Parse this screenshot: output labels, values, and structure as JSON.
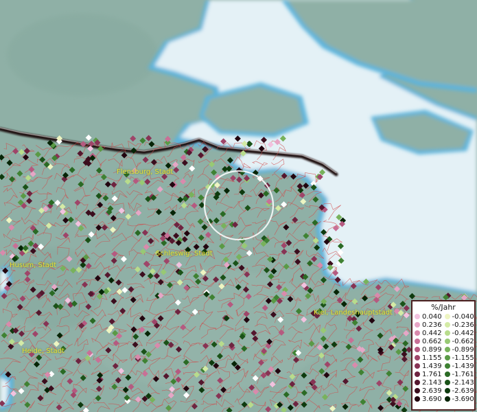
{
  "cities": [
    {
      "name": "Flensburg, Stadt"
    },
    {
      "name": "Husum, Stadt"
    },
    {
      "name": "Schleswig, Stadt"
    },
    {
      "name": "Kiel, Landeshauptstadt"
    },
    {
      "name": "Heide, Stadt"
    }
  ],
  "legend": {
    "title": "%/Jahr",
    "positive": [
      {
        "label": "0.040",
        "color": "#f2c2df"
      },
      {
        "label": "0.236",
        "color": "#e6a6c6"
      },
      {
        "label": "0.442",
        "color": "#d98aac"
      },
      {
        "label": "0.662",
        "color": "#c87096"
      },
      {
        "label": "0.899",
        "color": "#b55a80"
      },
      {
        "label": "1.155",
        "color": "#9f4569"
      },
      {
        "label": "1.439",
        "color": "#873354"
      },
      {
        "label": "1.761",
        "color": "#6e2440"
      },
      {
        "label": "2.143",
        "color": "#55172e"
      },
      {
        "label": "2.639",
        "color": "#3b0d1d"
      },
      {
        "label": "3.690",
        "color": "#22050f"
      }
    ],
    "negative": [
      {
        "label": "-0.040",
        "color": "#eef5c2"
      },
      {
        "label": "-0.236",
        "color": "#d4eba6"
      },
      {
        "label": "-0.442",
        "color": "#b8dc8c"
      },
      {
        "label": "-0.662",
        "color": "#98c974"
      },
      {
        "label": "-0.899",
        "color": "#78b25c"
      },
      {
        "label": "-1.155",
        "color": "#5a9a46"
      },
      {
        "label": "-1.439",
        "color": "#3f8233"
      },
      {
        "label": "-1.761",
        "color": "#2a6a24"
      },
      {
        "label": "-2.143",
        "color": "#1a5218"
      },
      {
        "label": "-2.639",
        "color": "#0e3a0e"
      },
      {
        "label": "-3.690",
        "color": "#062406"
      }
    ]
  },
  "colors": {
    "land": "#8fb0a6",
    "water": "#e4f1f6",
    "shore": "#5cb4dc",
    "border_line": "#1a0f0f",
    "municipal_boundary": "#d14a4a",
    "selection_circle": "#ffffff"
  }
}
